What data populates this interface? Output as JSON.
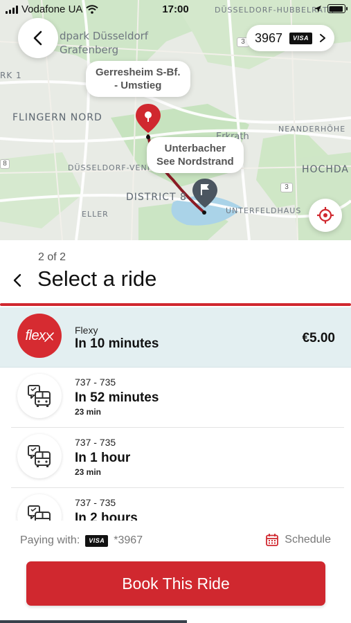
{
  "status_bar": {
    "carrier": "Vodafone UA",
    "time": "17:00",
    "battery_level": 0.95
  },
  "map": {
    "labels": {
      "park": "dpark Düsseldorf\nGrafenberg",
      "hubbelrath": "DÜSSELDORF-HUBBELRATH",
      "flingern": "FLINGERN NORD",
      "rk1": "RK 1",
      "neanderhohe": "NEANDERHÖHE",
      "hochdahl": "HOCHDA",
      "vennhausen": "DÜSSELDORF-VENN",
      "district8": "DISTRICT 8",
      "eller": "ELLER",
      "unterfeldhaus": "UNTERFELDHAUS",
      "erkrath": "Erkrath",
      "route3a": "3",
      "route3b": "3",
      "route8": "8"
    },
    "origin_bubble": "Gerresheim S-Bf.\n- Umstieg",
    "destination_bubble": "Unterbacher\nSee Nordstrand",
    "card_chip": {
      "last_digits": "3967",
      "brand": "VISA"
    }
  },
  "sheet": {
    "step": "2 of 2",
    "title": "Select a ride",
    "rides": [
      {
        "route": "Flexy",
        "eta": "In 10 minutes",
        "price": "€5.00",
        "duration": "",
        "icon": "flexy-logo-icon",
        "logo_text": "flex"
      },
      {
        "route": "737 - 735",
        "eta": "In 52 minutes",
        "duration": "23 min",
        "price": "",
        "icon": "bus-schedule-icon"
      },
      {
        "route": "737 - 735",
        "eta": "In 1 hour",
        "duration": "23 min",
        "price": "",
        "icon": "bus-schedule-icon"
      },
      {
        "route": "737 - 735",
        "eta": "In 2 hours",
        "duration": "",
        "price": "",
        "icon": "bus-schedule-icon"
      }
    ],
    "paying_label": "Paying with:",
    "paying_brand": "VISA",
    "paying_card": "*3967",
    "schedule_label": "Schedule",
    "book_button": "Book This Ride"
  },
  "colors": {
    "accent": "#d0282f",
    "selected_row": "#e3eff1",
    "route_line": "#8a1c25"
  }
}
